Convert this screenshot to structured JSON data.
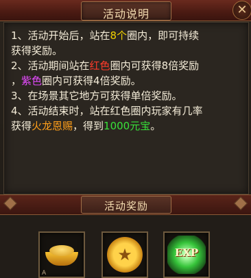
{
  "title": "活动说明",
  "close_symbol": "✕",
  "description": {
    "line1": {
      "a": "1、活动开始后，站在",
      "b": "8个",
      "c": "圈内，即可持续"
    },
    "line1b": "获得奖励。",
    "line2": {
      "a": "2、活动期间站在",
      "b": "红色",
      "c": "圈内可获得8倍奖励"
    },
    "line2b": {
      "a": "，",
      "b": "紫色",
      "c": "圈内可获得4倍奖励。"
    },
    "line3": "3、在场景其它地方可获得单倍奖励。",
    "line4": "4、活动结束时，站在红色圈内玩家有几率",
    "line4b": {
      "a": "获得",
      "b": "火龙恩赐",
      "c": "，得到",
      "d": "1000元宝",
      "e": "。"
    }
  },
  "rewards_header": "活动奖励",
  "rewards": [
    {
      "icon": "gold-ingot-icon",
      "tag": "A"
    },
    {
      "icon": "star-medal-icon"
    },
    {
      "icon": "exp-icon",
      "label": "EXP"
    }
  ],
  "colors": {
    "highlight_yellow": "#f2d200",
    "highlight_red": "#ff3b2a",
    "highlight_purple": "#e64bff",
    "highlight_green": "#38e23a",
    "highlight_orange": "#ff9f1a"
  }
}
